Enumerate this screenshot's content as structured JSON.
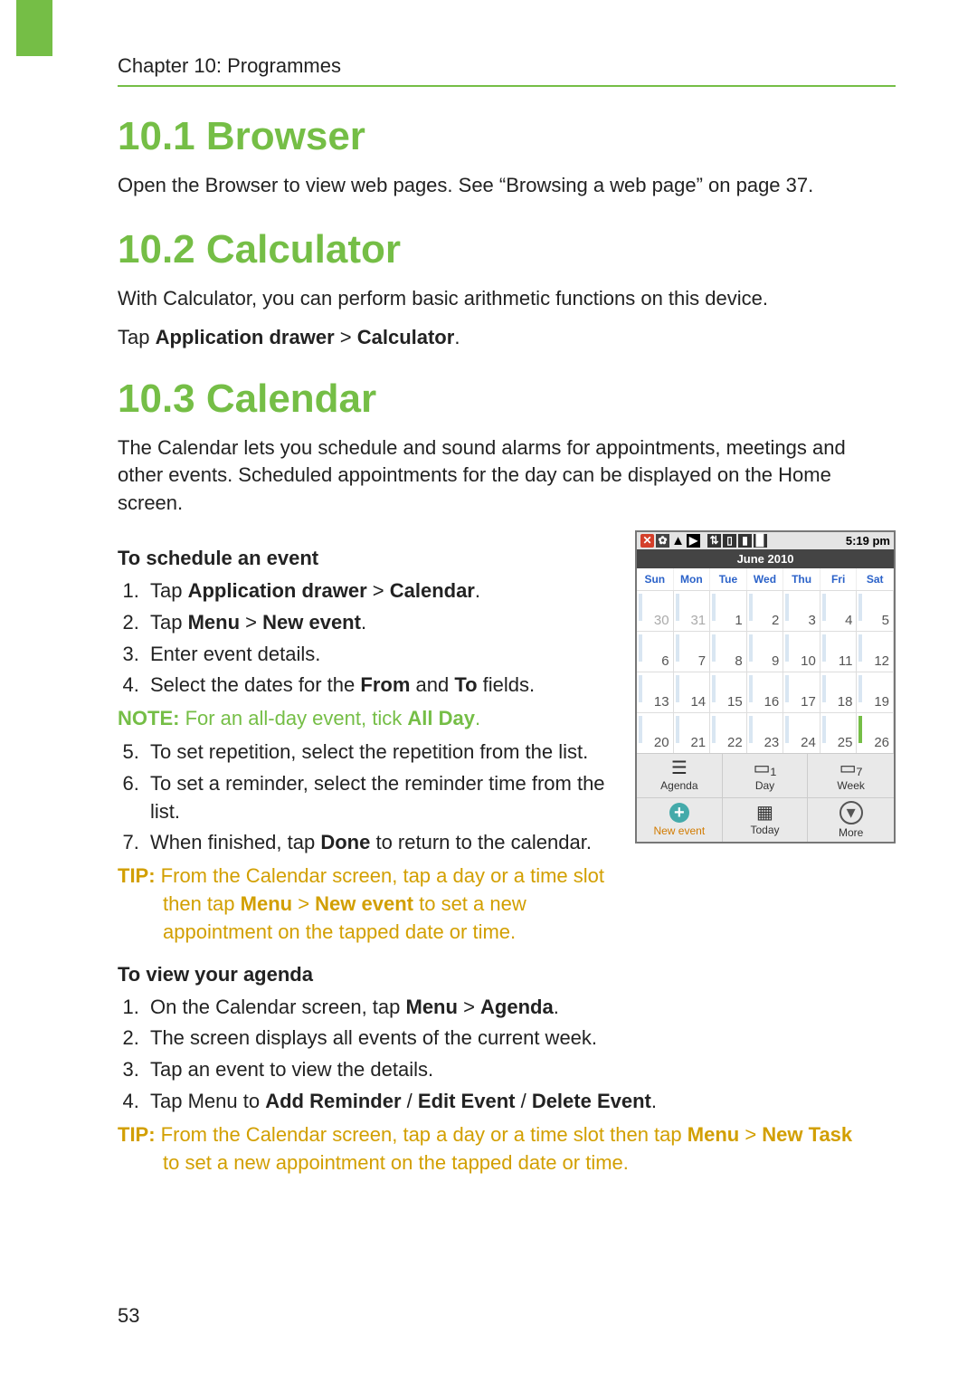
{
  "chapter": "Chapter 10: Programmes",
  "pageNumber": "53",
  "sections": {
    "browser": {
      "heading": "10.1 Browser",
      "body1": "Open the Browser to view web pages. See “Browsing a web page” on page 37."
    },
    "calculator": {
      "heading": "10.2 Calculator",
      "body1": "With Calculator, you can perform basic arithmetic functions on this device.",
      "instruction_prefix": "Tap ",
      "instruction_bold1": "Application drawer",
      "instruction_mid": " > ",
      "instruction_bold2": "Calculator",
      "instruction_suffix": "."
    },
    "calendar": {
      "heading": "10.3 Calendar",
      "body1": "The Calendar lets you schedule and sound alarms for appointments, meetings and other events. Scheduled appointments for the day can be displayed on the Home screen.",
      "schedule": {
        "subhead": "To schedule an event",
        "steps": [
          {
            "prefix": "Tap ",
            "b1": "Application drawer",
            "mid": " > ",
            "b2": "Calendar",
            "suffix": "."
          },
          {
            "prefix": "Tap ",
            "b1": "Menu",
            "mid": " > ",
            "b2": "New event",
            "suffix": "."
          },
          {
            "text": "Enter event details."
          },
          {
            "prefix": "Select the dates for the ",
            "b1": "From",
            "mid": " and ",
            "b2": "To",
            "suffix": " fields."
          }
        ],
        "note": {
          "lead": "NOTE:",
          "body_prefix": " For an all-day event, tick ",
          "body_bold": "All Day",
          "body_suffix": "."
        },
        "steps2": [
          {
            "text": "To set repetition, select the repetition from the list."
          },
          {
            "text": "To set a reminder, select the reminder time from the list."
          },
          {
            "prefix": "When finished, tap ",
            "b1": "Done",
            "suffix": " to return to the calendar."
          }
        ],
        "tip": {
          "lead": "TIP:",
          "line1": " From the Calendar screen, tap a day or a time slot",
          "line2_prefix": "then tap ",
          "b1": "Menu",
          "mid": " > ",
          "b2": "New event",
          "line2_suffix": " to set a new",
          "line3": "appointment on the tapped date or time."
        }
      },
      "agenda": {
        "subhead": "To view your agenda",
        "steps": [
          {
            "prefix": "On the Calendar screen, tap ",
            "b1": "Menu",
            "mid": " > ",
            "b2": "Agenda",
            "suffix": "."
          },
          {
            "text": "The screen displays all events of the current week."
          },
          {
            "text": "Tap an event to view the details."
          },
          {
            "prefix": "Tap Menu to ",
            "b1": "Add Reminder",
            "mid1": " / ",
            "b2": "Edit Event",
            "mid2": " / ",
            "b3": "Delete Event",
            "suffix": "."
          }
        ],
        "tip": {
          "lead": "TIP:",
          "line1": " From the Calendar screen, tap a day or a time slot then tap ",
          "b1": "Menu",
          "mid": " > ",
          "b2": "New Task",
          "line2": "to set a new appointment on the tapped date or time."
        }
      }
    }
  },
  "phone": {
    "clock": "5:19 pm",
    "month": "June 2010",
    "dayLabels": [
      "Sun",
      "Mon",
      "Tue",
      "Wed",
      "Thu",
      "Fri",
      "Sat"
    ],
    "weeks": [
      [
        {
          "n": "30",
          "dim": true
        },
        {
          "n": "31",
          "dim": true
        },
        {
          "n": "1"
        },
        {
          "n": "2"
        },
        {
          "n": "3"
        },
        {
          "n": "4"
        },
        {
          "n": "5"
        }
      ],
      [
        {
          "n": "6"
        },
        {
          "n": "7"
        },
        {
          "n": "8"
        },
        {
          "n": "9"
        },
        {
          "n": "10"
        },
        {
          "n": "11"
        },
        {
          "n": "12"
        }
      ],
      [
        {
          "n": "13"
        },
        {
          "n": "14"
        },
        {
          "n": "15"
        },
        {
          "n": "16"
        },
        {
          "n": "17"
        },
        {
          "n": "18"
        },
        {
          "n": "19"
        }
      ],
      [
        {
          "n": "20"
        },
        {
          "n": "21"
        },
        {
          "n": "22"
        },
        {
          "n": "23"
        },
        {
          "n": "24"
        },
        {
          "n": "25"
        },
        {
          "n": "26",
          "green": true
        }
      ]
    ],
    "toolbar": {
      "agenda": "Agenda",
      "day": "Day",
      "week": "Week",
      "newEvent": "New event",
      "today": "Today",
      "more": "More"
    }
  }
}
